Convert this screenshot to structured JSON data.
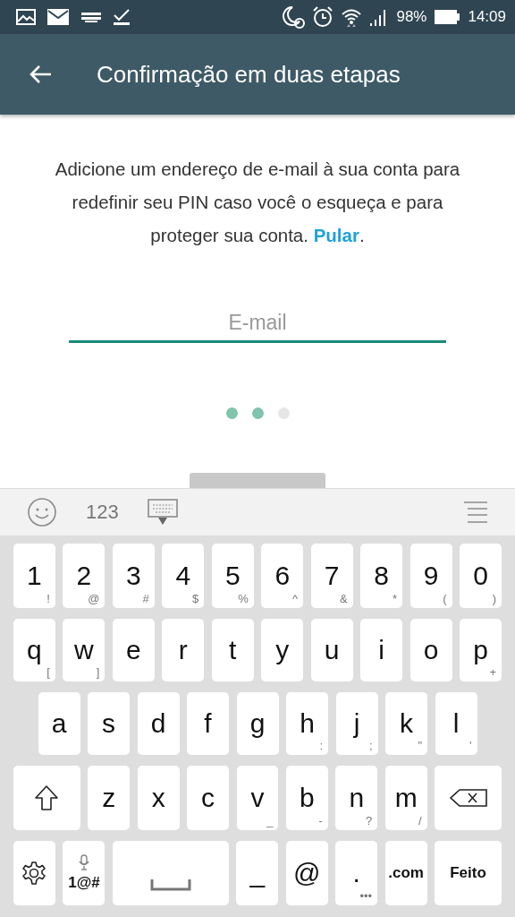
{
  "status_bar": {
    "battery_percent": "98%",
    "time": "14:09"
  },
  "app_bar": {
    "title": "Confirmação em duas etapas"
  },
  "intro": {
    "text": "Adicione um endereço de e-mail à sua conta para redefinir seu PIN caso você o esqueça e para proteger sua conta. ",
    "link": "Pular",
    "end": "."
  },
  "email_field": {
    "placeholder": "E-mail"
  },
  "page_dots": [
    {
      "active": true
    },
    {
      "active": true
    },
    {
      "active": false
    }
  ],
  "keyboard": {
    "toolbar": {
      "numbers_label": "123"
    },
    "rows": [
      [
        {
          "kind": "char",
          "label": "1",
          "hint": "!"
        },
        {
          "kind": "char",
          "label": "2",
          "hint": "@"
        },
        {
          "kind": "char",
          "label": "3",
          "hint": "#"
        },
        {
          "kind": "char",
          "label": "4",
          "hint": "$"
        },
        {
          "kind": "char",
          "label": "5",
          "hint": "%"
        },
        {
          "kind": "char",
          "label": "6",
          "hint": "^"
        },
        {
          "kind": "char",
          "label": "7",
          "hint": "&"
        },
        {
          "kind": "char",
          "label": "8",
          "hint": "*"
        },
        {
          "kind": "char",
          "label": "9",
          "hint": "("
        },
        {
          "kind": "char",
          "label": "0",
          "hint": ")"
        }
      ],
      [
        {
          "kind": "char",
          "label": "q",
          "hint": "["
        },
        {
          "kind": "char",
          "label": "w",
          "hint": "]"
        },
        {
          "kind": "char",
          "label": "e"
        },
        {
          "kind": "char",
          "label": "r"
        },
        {
          "kind": "char",
          "label": "t"
        },
        {
          "kind": "char",
          "label": "y"
        },
        {
          "kind": "char",
          "label": "u"
        },
        {
          "kind": "char",
          "label": "i"
        },
        {
          "kind": "char",
          "label": "o"
        },
        {
          "kind": "char",
          "label": "p",
          "hint": "+"
        }
      ],
      [
        {
          "kind": "char",
          "label": "a"
        },
        {
          "kind": "char",
          "label": "s"
        },
        {
          "kind": "char",
          "label": "d"
        },
        {
          "kind": "char",
          "label": "f"
        },
        {
          "kind": "char",
          "label": "g"
        },
        {
          "kind": "char",
          "label": "h",
          "hint": ":"
        },
        {
          "kind": "char",
          "label": "j",
          "hint": ";"
        },
        {
          "kind": "char",
          "label": "k",
          "hint": "\""
        },
        {
          "kind": "char",
          "label": "l",
          "hint": "'"
        }
      ],
      [
        {
          "kind": "shift"
        },
        {
          "kind": "char",
          "label": "z"
        },
        {
          "kind": "char",
          "label": "x"
        },
        {
          "kind": "char",
          "label": "c"
        },
        {
          "kind": "char",
          "label": "v",
          "hint": "_"
        },
        {
          "kind": "char",
          "label": "b",
          "hint": "-"
        },
        {
          "kind": "char",
          "label": "n",
          "hint": "?"
        },
        {
          "kind": "char",
          "label": "m",
          "hint": "/"
        },
        {
          "kind": "backspace"
        }
      ],
      [
        {
          "kind": "settings"
        },
        {
          "kind": "symbols",
          "label": "1@#"
        },
        {
          "kind": "space"
        },
        {
          "kind": "char",
          "label": "_"
        },
        {
          "kind": "char",
          "label": "@"
        },
        {
          "kind": "char",
          "label": ".",
          "hint": "•••"
        },
        {
          "kind": "small",
          "label": ".com"
        },
        {
          "kind": "done",
          "label": "Feito"
        }
      ]
    ]
  }
}
